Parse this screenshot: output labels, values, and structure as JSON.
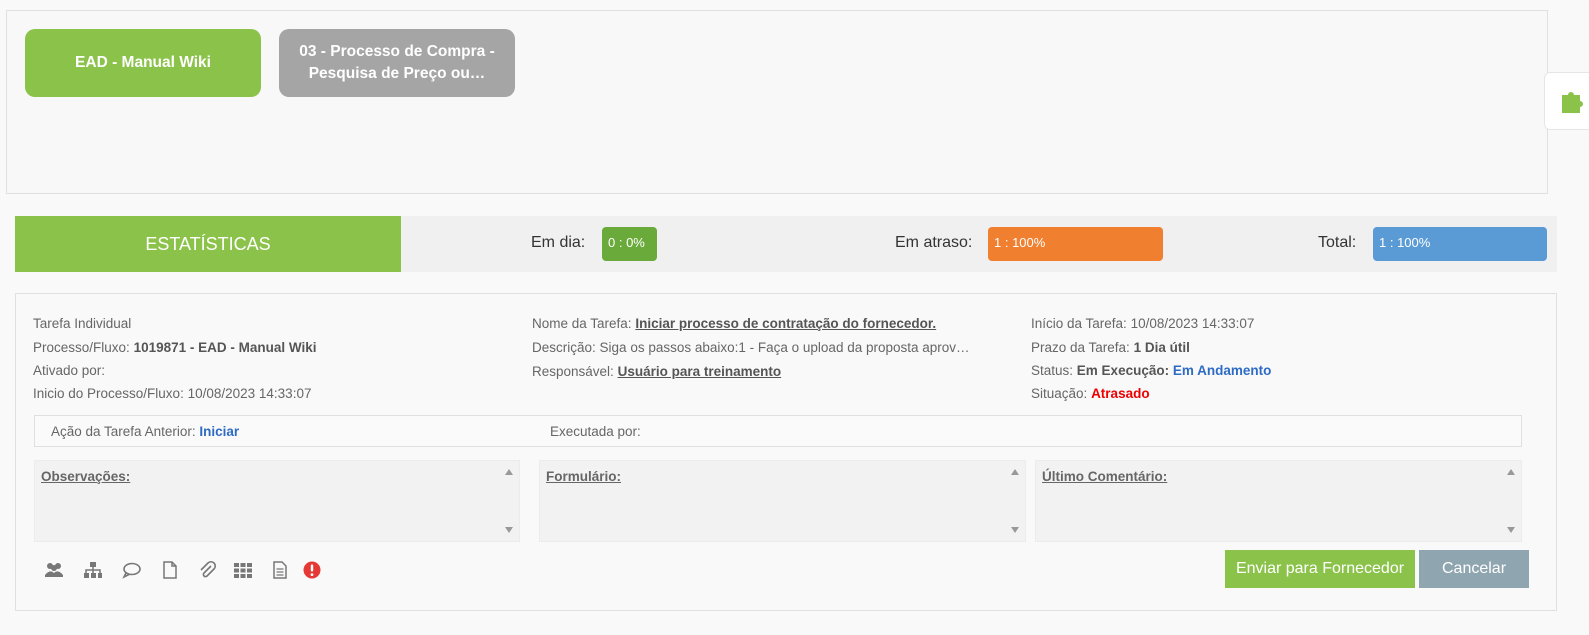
{
  "breadcrumbs": [
    {
      "label": "EAD - Manual Wiki"
    },
    {
      "label": "03 - Processo de Compra - Pesquisa de Preço ou…"
    }
  ],
  "stats": {
    "title": "ESTATÍSTICAS",
    "on_time_label": "Em dia:",
    "on_time_value": "0 : 0%",
    "late_label": "Em atraso:",
    "late_value": "1 : 100%",
    "total_label": "Total:",
    "total_value": "1 : 100%",
    "colors": {
      "on_time": "#6aaa3a",
      "late": "#f08030",
      "total": "#5b9bd5",
      "accent": "#8bc34a"
    }
  },
  "task": {
    "type": "Tarefa Individual",
    "process_label": "Processo/Fluxo:",
    "process_value": "1019871 - EAD - Manual Wiki",
    "activated_by_label": "Ativado por:",
    "process_start_label": "Inicio do Processo/Fluxo:",
    "process_start_value": "10/08/2023 14:33:07",
    "name_label": "Nome da Tarefa:",
    "name_value": "Iniciar processo de contratação do fornecedor.",
    "description_label": "Descrição:",
    "description_value": "Siga os passos abaixo:1 - Faça o upload da proposta aprov…",
    "responsible_label": "Responsável:",
    "responsible_value": "Usuário para treinamento",
    "start_label": "Início da Tarefa:",
    "start_value": "10/08/2023 14:33:07",
    "deadline_label": "Prazo da Tarefa:",
    "deadline_value": "1 Dia útil",
    "status_label": "Status:",
    "status_exec": "Em Execução:",
    "status_value": "Em Andamento",
    "situation_label": "Situação:",
    "situation_value": "Atrasado",
    "prev_action_label": "Ação da Tarefa Anterior:",
    "prev_action_value": "Iniciar",
    "executed_by_label": "Executada por:"
  },
  "panels": {
    "observations": "Observações:",
    "form": "Formulário:",
    "last_comment": "Último Comentário:"
  },
  "toolbar_icons": [
    "users-icon",
    "org-chart-icon",
    "comment-icon",
    "document-icon",
    "attachment-icon",
    "grid-icon",
    "text-document-icon",
    "alert-icon"
  ],
  "actions": {
    "send": "Enviar para Fornecedor",
    "cancel": "Cancelar"
  }
}
